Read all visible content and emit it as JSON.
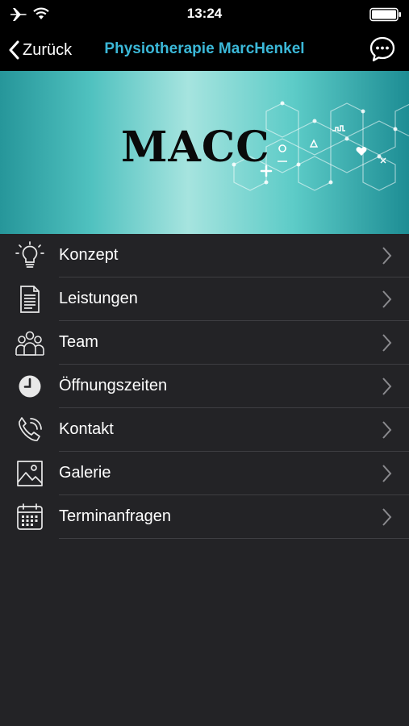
{
  "status": {
    "time": "13:24"
  },
  "nav": {
    "back_label": "Zurück",
    "title": "Physiotherapie MarcHenkel",
    "title_color": "#3bb8d8"
  },
  "banner": {
    "text": "MACC"
  },
  "menu": [
    {
      "label": "Konzept",
      "icon": "lightbulb-icon"
    },
    {
      "label": "Leistungen",
      "icon": "document-icon"
    },
    {
      "label": "Team",
      "icon": "team-icon"
    },
    {
      "label": "Öffnungszeiten",
      "icon": "clock-icon"
    },
    {
      "label": "Kontakt",
      "icon": "phone-icon"
    },
    {
      "label": "Galerie",
      "icon": "image-icon"
    },
    {
      "label": "Terminanfragen",
      "icon": "calendar-icon"
    }
  ]
}
